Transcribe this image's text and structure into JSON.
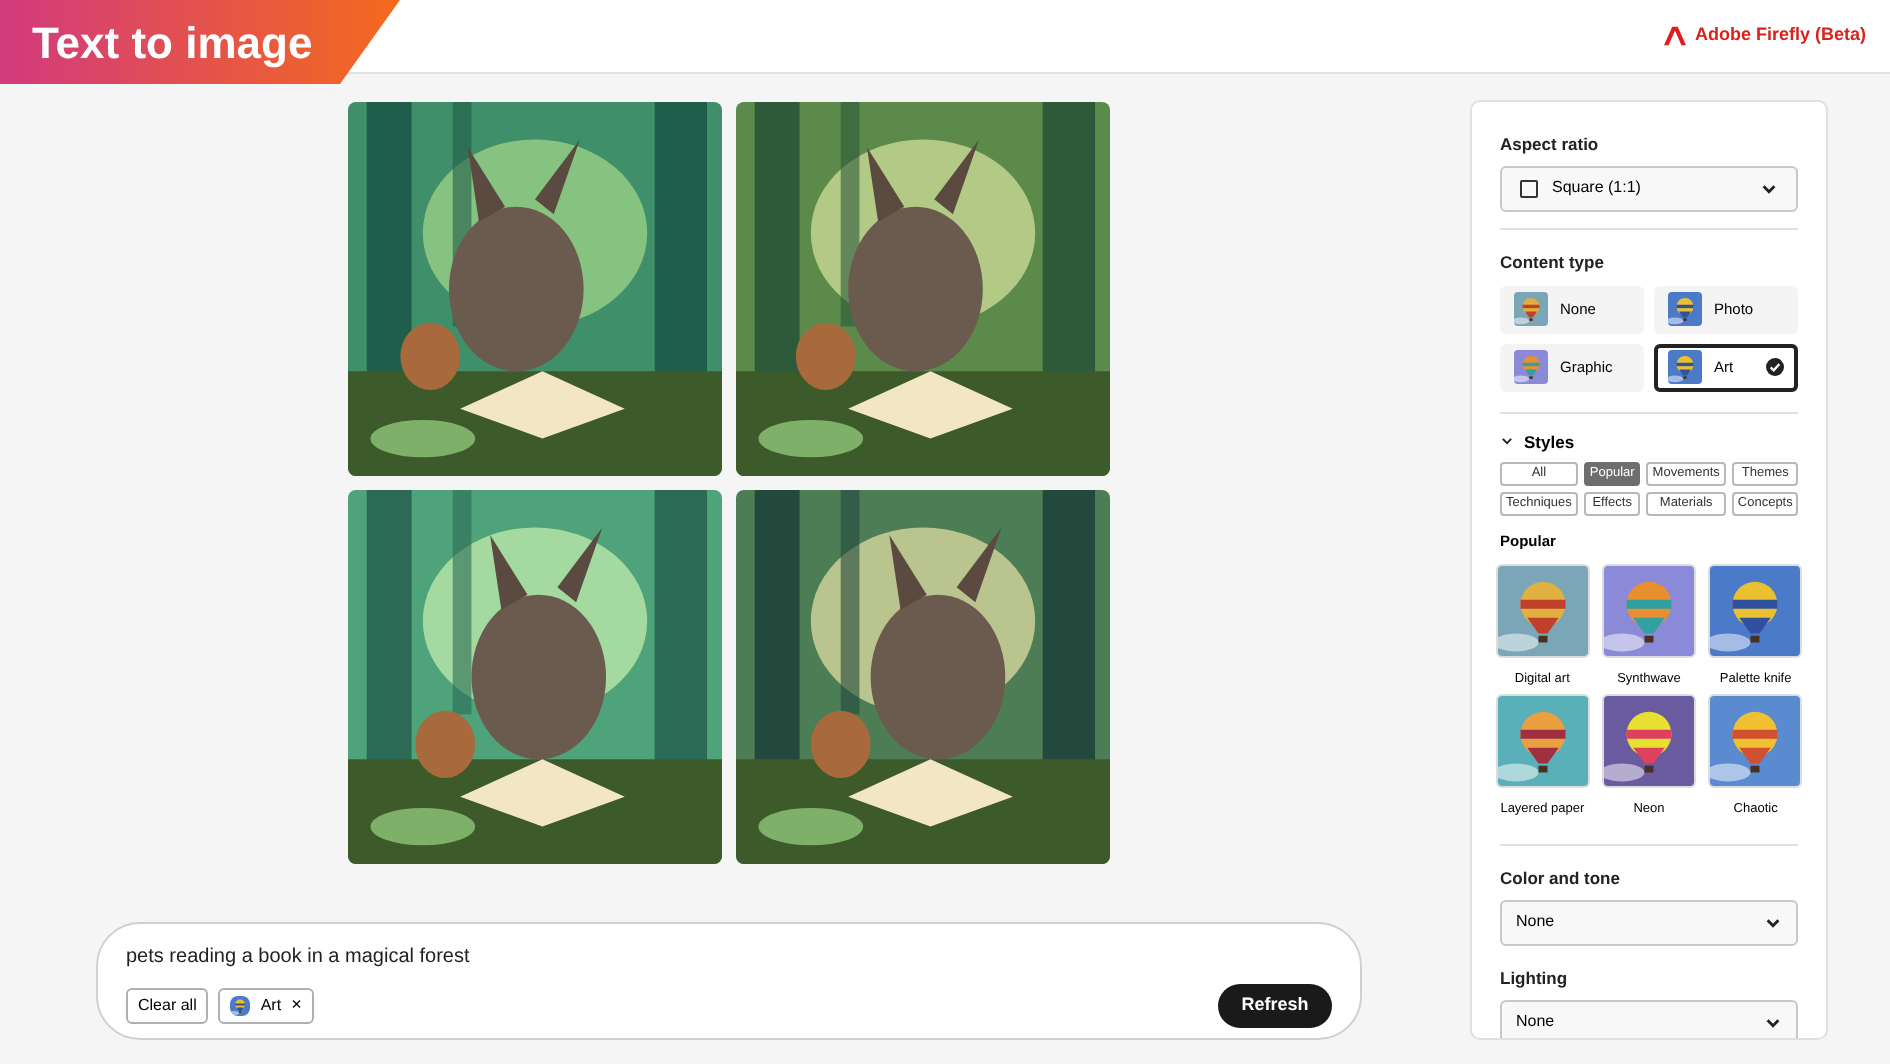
{
  "header": {
    "title": "Text to image",
    "brand": "Adobe Firefly (Beta)"
  },
  "prompt": {
    "value": "pets reading a book in a magical forest",
    "clear_label": "Clear all",
    "chips": [
      {
        "label": "Art",
        "remove": "×"
      }
    ],
    "submit": "Refresh"
  },
  "panel": {
    "aspect_ratio": {
      "label": "Aspect ratio",
      "value": "Square (1:1)"
    },
    "content_type": {
      "label": "Content type",
      "options": [
        {
          "label": "None",
          "selected": false
        },
        {
          "label": "Photo",
          "selected": false
        },
        {
          "label": "Graphic",
          "selected": false
        },
        {
          "label": "Art",
          "selected": true
        }
      ]
    },
    "styles": {
      "label": "Styles",
      "expanded": true,
      "filters": [
        {
          "label": "All",
          "selected": false
        },
        {
          "label": "Popular",
          "selected": true
        },
        {
          "label": "Movements",
          "selected": false
        },
        {
          "label": "Themes",
          "selected": false
        },
        {
          "label": "Techniques",
          "selected": false
        },
        {
          "label": "Effects",
          "selected": false
        },
        {
          "label": "Materials",
          "selected": false
        },
        {
          "label": "Concepts",
          "selected": false
        }
      ],
      "section": "Popular",
      "items": [
        {
          "label": "Digital art"
        },
        {
          "label": "Synthwave"
        },
        {
          "label": "Palette knife"
        },
        {
          "label": "Layered paper"
        },
        {
          "label": "Neon"
        },
        {
          "label": "Chaotic"
        }
      ]
    },
    "color_tone": {
      "label": "Color and tone",
      "value": "None"
    },
    "lighting": {
      "label": "Lighting",
      "value": "None"
    }
  }
}
